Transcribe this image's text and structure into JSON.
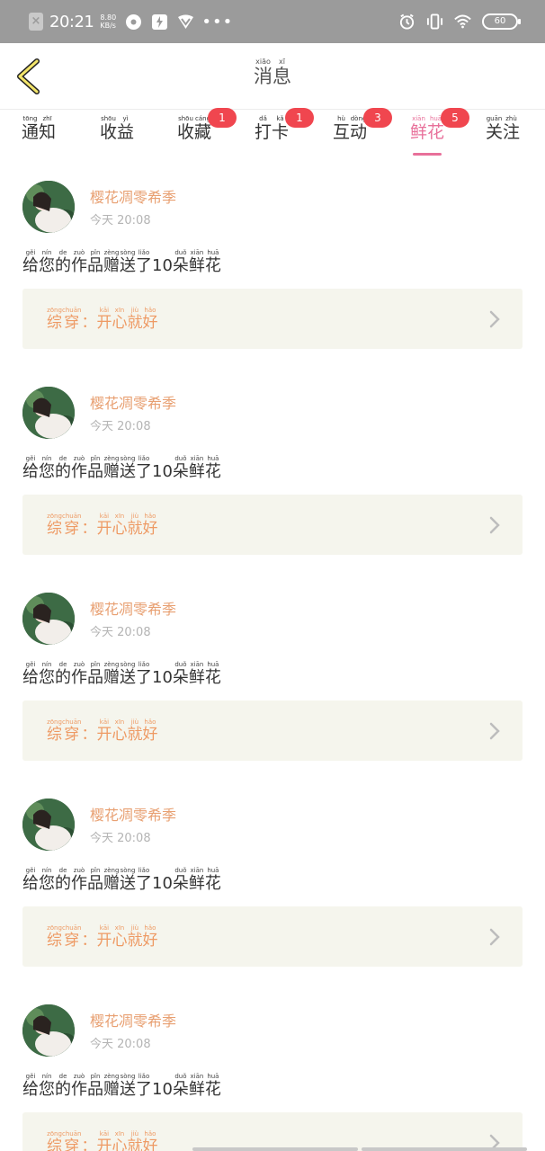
{
  "status_bar": {
    "time": "20:21",
    "net_speed_value": "8.80",
    "net_speed_unit": "KB/s",
    "battery": "60",
    "dots": "•••"
  },
  "header": {
    "title": [
      {
        "char": "消",
        "pinyin": "xiāo"
      },
      {
        "char": "息",
        "pinyin": "xī"
      }
    ]
  },
  "tabs": [
    {
      "chars": [
        {
          "char": "通",
          "pinyin": "tōng"
        },
        {
          "char": "知",
          "pinyin": "zhī"
        }
      ],
      "badge": "",
      "active": false
    },
    {
      "chars": [
        {
          "char": "收",
          "pinyin": "shōu"
        },
        {
          "char": "益",
          "pinyin": "yì"
        }
      ],
      "badge": "",
      "active": false
    },
    {
      "chars": [
        {
          "char": "收",
          "pinyin": "shōu"
        },
        {
          "char": "藏",
          "pinyin": "cáng"
        }
      ],
      "badge": "1",
      "active": false
    },
    {
      "chars": [
        {
          "char": "打",
          "pinyin": "dǎ"
        },
        {
          "char": "卡",
          "pinyin": "kǎ"
        }
      ],
      "badge": "1",
      "active": false
    },
    {
      "chars": [
        {
          "char": "互",
          "pinyin": "hù"
        },
        {
          "char": "动",
          "pinyin": "dòng"
        }
      ],
      "badge": "3",
      "active": false
    },
    {
      "chars": [
        {
          "char": "鲜",
          "pinyin": "xiān"
        },
        {
          "char": "花",
          "pinyin": "huā"
        }
      ],
      "badge": "5",
      "active": true
    },
    {
      "chars": [
        {
          "char": "关",
          "pinyin": "guān"
        },
        {
          "char": "注",
          "pinyin": "zhù"
        }
      ],
      "badge": "",
      "active": false
    }
  ],
  "messages": [
    {
      "username": "樱花凋零希季",
      "time": "今天 20:08",
      "text": [
        {
          "char": "给",
          "pinyin": "gěi"
        },
        {
          "char": "您",
          "pinyin": "nín"
        },
        {
          "char": "的",
          "pinyin": "de"
        },
        {
          "char": "作",
          "pinyin": "zuò"
        },
        {
          "char": "品",
          "pinyin": "pǐn"
        },
        {
          "char": "赠",
          "pinyin": "zèng"
        },
        {
          "char": "送",
          "pinyin": "sòng"
        },
        {
          "char": "了",
          "pinyin": "liǎo"
        },
        {
          "char": "10",
          "pinyin": ""
        },
        {
          "char": "朵",
          "pinyin": "duǒ"
        },
        {
          "char": "鲜",
          "pinyin": "xiān"
        },
        {
          "char": "花",
          "pinyin": "huā"
        }
      ],
      "work": [
        {
          "char": "综",
          "pinyin": "zōng"
        },
        {
          "char": "穿",
          "pinyin": "chuān"
        },
        {
          "char": "：",
          "pinyin": ""
        },
        {
          "char": "开",
          "pinyin": "kāi"
        },
        {
          "char": "心",
          "pinyin": "xīn"
        },
        {
          "char": "就",
          "pinyin": "jiù"
        },
        {
          "char": "好",
          "pinyin": "hǎo"
        }
      ]
    },
    {
      "username": "樱花凋零希季",
      "time": "今天 20:08",
      "text": [
        {
          "char": "给",
          "pinyin": "gěi"
        },
        {
          "char": "您",
          "pinyin": "nín"
        },
        {
          "char": "的",
          "pinyin": "de"
        },
        {
          "char": "作",
          "pinyin": "zuò"
        },
        {
          "char": "品",
          "pinyin": "pǐn"
        },
        {
          "char": "赠",
          "pinyin": "zèng"
        },
        {
          "char": "送",
          "pinyin": "sòng"
        },
        {
          "char": "了",
          "pinyin": "liǎo"
        },
        {
          "char": "10",
          "pinyin": ""
        },
        {
          "char": "朵",
          "pinyin": "duǒ"
        },
        {
          "char": "鲜",
          "pinyin": "xiān"
        },
        {
          "char": "花",
          "pinyin": "huā"
        }
      ],
      "work": [
        {
          "char": "综",
          "pinyin": "zōng"
        },
        {
          "char": "穿",
          "pinyin": "chuān"
        },
        {
          "char": "：",
          "pinyin": ""
        },
        {
          "char": "开",
          "pinyin": "kāi"
        },
        {
          "char": "心",
          "pinyin": "xīn"
        },
        {
          "char": "就",
          "pinyin": "jiù"
        },
        {
          "char": "好",
          "pinyin": "hǎo"
        }
      ]
    },
    {
      "username": "樱花凋零希季",
      "time": "今天 20:08",
      "text": [
        {
          "char": "给",
          "pinyin": "gěi"
        },
        {
          "char": "您",
          "pinyin": "nín"
        },
        {
          "char": "的",
          "pinyin": "de"
        },
        {
          "char": "作",
          "pinyin": "zuò"
        },
        {
          "char": "品",
          "pinyin": "pǐn"
        },
        {
          "char": "赠",
          "pinyin": "zèng"
        },
        {
          "char": "送",
          "pinyin": "sòng"
        },
        {
          "char": "了",
          "pinyin": "liǎo"
        },
        {
          "char": "10",
          "pinyin": ""
        },
        {
          "char": "朵",
          "pinyin": "duǒ"
        },
        {
          "char": "鲜",
          "pinyin": "xiān"
        },
        {
          "char": "花",
          "pinyin": "huā"
        }
      ],
      "work": [
        {
          "char": "综",
          "pinyin": "zōng"
        },
        {
          "char": "穿",
          "pinyin": "chuān"
        },
        {
          "char": "：",
          "pinyin": ""
        },
        {
          "char": "开",
          "pinyin": "kāi"
        },
        {
          "char": "心",
          "pinyin": "xīn"
        },
        {
          "char": "就",
          "pinyin": "jiù"
        },
        {
          "char": "好",
          "pinyin": "hǎo"
        }
      ]
    },
    {
      "username": "樱花凋零希季",
      "time": "今天 20:08",
      "text": [
        {
          "char": "给",
          "pinyin": "gěi"
        },
        {
          "char": "您",
          "pinyin": "nín"
        },
        {
          "char": "的",
          "pinyin": "de"
        },
        {
          "char": "作",
          "pinyin": "zuò"
        },
        {
          "char": "品",
          "pinyin": "pǐn"
        },
        {
          "char": "赠",
          "pinyin": "zèng"
        },
        {
          "char": "送",
          "pinyin": "sòng"
        },
        {
          "char": "了",
          "pinyin": "liǎo"
        },
        {
          "char": "10",
          "pinyin": ""
        },
        {
          "char": "朵",
          "pinyin": "duǒ"
        },
        {
          "char": "鲜",
          "pinyin": "xiān"
        },
        {
          "char": "花",
          "pinyin": "huā"
        }
      ],
      "work": [
        {
          "char": "综",
          "pinyin": "zōng"
        },
        {
          "char": "穿",
          "pinyin": "chuān"
        },
        {
          "char": "：",
          "pinyin": ""
        },
        {
          "char": "开",
          "pinyin": "kāi"
        },
        {
          "char": "心",
          "pinyin": "xīn"
        },
        {
          "char": "就",
          "pinyin": "jiù"
        },
        {
          "char": "好",
          "pinyin": "hǎo"
        }
      ]
    },
    {
      "username": "樱花凋零希季",
      "time": "今天 20:08",
      "text": [
        {
          "char": "给",
          "pinyin": "gěi"
        },
        {
          "char": "您",
          "pinyin": "nín"
        },
        {
          "char": "的",
          "pinyin": "de"
        },
        {
          "char": "作",
          "pinyin": "zuò"
        },
        {
          "char": "品",
          "pinyin": "pǐn"
        },
        {
          "char": "赠",
          "pinyin": "zèng"
        },
        {
          "char": "送",
          "pinyin": "sòng"
        },
        {
          "char": "了",
          "pinyin": "liǎo"
        },
        {
          "char": "10",
          "pinyin": ""
        },
        {
          "char": "朵",
          "pinyin": "duǒ"
        },
        {
          "char": "鲜",
          "pinyin": "xiān"
        },
        {
          "char": "花",
          "pinyin": "huā"
        }
      ],
      "work": [
        {
          "char": "综",
          "pinyin": "zōng"
        },
        {
          "char": "穿",
          "pinyin": "chuān"
        },
        {
          "char": "：",
          "pinyin": ""
        },
        {
          "char": "开",
          "pinyin": "kāi"
        },
        {
          "char": "心",
          "pinyin": "xīn"
        },
        {
          "char": "就",
          "pinyin": "jiù"
        },
        {
          "char": "好",
          "pinyin": "hǎo"
        }
      ]
    }
  ],
  "colors": {
    "accent": "#e8709a",
    "badge": "#f0464f",
    "username": "#e8a072",
    "work_text": "#ee9a64",
    "work_bg": "#f5f5ed",
    "status_bar": "#9b9b9b"
  },
  "icons": {
    "back": "chevron-left-icon",
    "work_arrow": "chevron-right-icon"
  }
}
